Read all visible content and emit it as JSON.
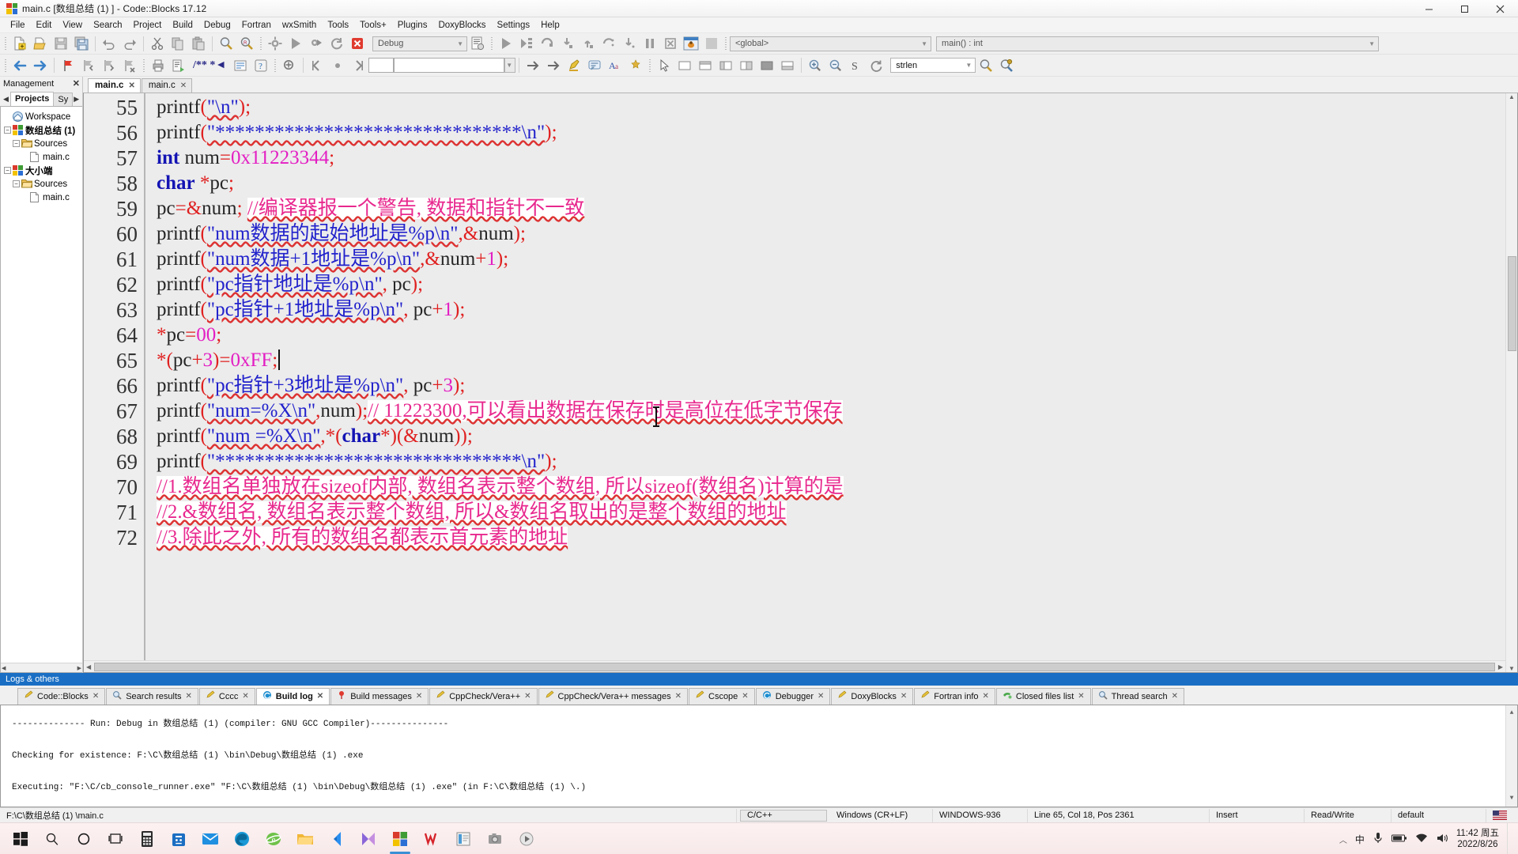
{
  "window": {
    "title": "main.c [数组总结 (1) ] - Code::Blocks 17.12",
    "icon": "codeblocks-logo-icon",
    "minimize": "—",
    "maximize": "▢",
    "close": "✕"
  },
  "menubar": {
    "items": [
      {
        "label": "File"
      },
      {
        "label": "Edit"
      },
      {
        "label": "View"
      },
      {
        "label": "Search"
      },
      {
        "label": "Project"
      },
      {
        "label": "Build"
      },
      {
        "label": "Debug"
      },
      {
        "label": "Fortran"
      },
      {
        "label": "wxSmith"
      },
      {
        "label": "Tools"
      },
      {
        "label": "Tools+"
      },
      {
        "label": "Plugins"
      },
      {
        "label": "DoxyBlocks"
      },
      {
        "label": "Settings"
      },
      {
        "label": "Help"
      }
    ]
  },
  "toolbar_main": {
    "build_target": "Debug",
    "scope_combo": "<global>",
    "function_combo": "main() : int"
  },
  "toolbar_second": {
    "doxy_label": "/** *◄",
    "search_field": "",
    "find_combo": "strlen"
  },
  "management": {
    "title": "Management",
    "close": "✕",
    "tabs": [
      {
        "label": "Projects",
        "active": true
      },
      {
        "label": "Sy",
        "active": false
      }
    ],
    "tree": [
      {
        "label": "Workspace",
        "level": 0,
        "icon": "workspace-icon",
        "expander": "",
        "bold": false
      },
      {
        "label": "数组总结 (1)",
        "level": 0,
        "icon": "project-icon",
        "expander": "−",
        "bold": true
      },
      {
        "label": "Sources",
        "level": 1,
        "icon": "folder-icon",
        "expander": "−",
        "bold": false
      },
      {
        "label": "main.c",
        "level": 2,
        "icon": "file-icon",
        "expander": "",
        "bold": false
      },
      {
        "label": "大小端",
        "level": 0,
        "icon": "project-icon",
        "expander": "−",
        "bold": true
      },
      {
        "label": "Sources",
        "level": 1,
        "icon": "folder-icon",
        "expander": "−",
        "bold": false
      },
      {
        "label": "main.c",
        "level": 2,
        "icon": "file-icon",
        "expander": "",
        "bold": false
      }
    ]
  },
  "editor": {
    "tabs": [
      {
        "label": "main.c",
        "active": true,
        "close": "✕"
      },
      {
        "label": "main.c",
        "active": false,
        "close": "✕"
      }
    ],
    "first_line": 55,
    "lines": [
      {
        "n": 55,
        "tokens": [
          {
            "t": "    ",
            "c": "plain"
          },
          {
            "t": "printf",
            "c": "plain"
          },
          {
            "t": "(",
            "c": "punc"
          },
          {
            "t": "\"\\n\"",
            "c": "str"
          },
          {
            "t": ")",
            "c": "punc"
          },
          {
            "t": ";",
            "c": "punc"
          }
        ]
      },
      {
        "n": 56,
        "tokens": [
          {
            "t": "    ",
            "c": "plain"
          },
          {
            "t": "printf",
            "c": "plain"
          },
          {
            "t": "(",
            "c": "punc"
          },
          {
            "t": "\"*******************************\\n\"",
            "c": "str"
          },
          {
            "t": ")",
            "c": "punc"
          },
          {
            "t": ";",
            "c": "punc"
          }
        ]
      },
      {
        "n": 57,
        "tokens": [
          {
            "t": "    ",
            "c": "plain"
          },
          {
            "t": "int",
            "c": "kw"
          },
          {
            "t": " num",
            "c": "plain"
          },
          {
            "t": "=",
            "c": "punc"
          },
          {
            "t": "0x11223344",
            "c": "num"
          },
          {
            "t": ";",
            "c": "punc"
          }
        ]
      },
      {
        "n": 58,
        "tokens": [
          {
            "t": "    ",
            "c": "plain"
          },
          {
            "t": "char",
            "c": "kw"
          },
          {
            "t": " ",
            "c": "plain"
          },
          {
            "t": "*",
            "c": "op"
          },
          {
            "t": "pc",
            "c": "plain"
          },
          {
            "t": ";",
            "c": "punc"
          }
        ]
      },
      {
        "n": 59,
        "tokens": [
          {
            "t": "    ",
            "c": "plain"
          },
          {
            "t": "pc",
            "c": "plain"
          },
          {
            "t": "=",
            "c": "punc"
          },
          {
            "t": "&",
            "c": "op"
          },
          {
            "t": "num",
            "c": "plain"
          },
          {
            "t": ";",
            "c": "punc"
          },
          {
            "t": "  ",
            "c": "plain"
          },
          {
            "t": "//编译器报一个警告,  数据和指针不一致",
            "c": "cmt"
          }
        ]
      },
      {
        "n": 60,
        "tokens": [
          {
            "t": "    ",
            "c": "plain"
          },
          {
            "t": "printf",
            "c": "plain"
          },
          {
            "t": "(",
            "c": "punc"
          },
          {
            "t": "\"num数据的起始地址是%p\\n\"",
            "c": "str"
          },
          {
            "t": ",",
            "c": "punc"
          },
          {
            "t": "&",
            "c": "op"
          },
          {
            "t": "num",
            "c": "plain"
          },
          {
            "t": ")",
            "c": "punc"
          },
          {
            "t": ";",
            "c": "punc"
          }
        ]
      },
      {
        "n": 61,
        "tokens": [
          {
            "t": "    ",
            "c": "plain"
          },
          {
            "t": "printf",
            "c": "plain"
          },
          {
            "t": "(",
            "c": "punc"
          },
          {
            "t": "\"num数据+1地址是%p\\n\"",
            "c": "str"
          },
          {
            "t": ",",
            "c": "punc"
          },
          {
            "t": "&",
            "c": "op"
          },
          {
            "t": "num",
            "c": "plain"
          },
          {
            "t": "+",
            "c": "punc"
          },
          {
            "t": "1",
            "c": "num"
          },
          {
            "t": ")",
            "c": "punc"
          },
          {
            "t": ";",
            "c": "punc"
          }
        ]
      },
      {
        "n": 62,
        "tokens": [
          {
            "t": "    ",
            "c": "plain"
          },
          {
            "t": "printf",
            "c": "plain"
          },
          {
            "t": "(",
            "c": "punc"
          },
          {
            "t": "\"pc指针地址是%p\\n\"",
            "c": "str"
          },
          {
            "t": ",",
            "c": "punc"
          },
          {
            "t": " pc",
            "c": "plain"
          },
          {
            "t": ")",
            "c": "punc"
          },
          {
            "t": ";",
            "c": "punc"
          }
        ]
      },
      {
        "n": 63,
        "tokens": [
          {
            "t": "    ",
            "c": "plain"
          },
          {
            "t": "printf",
            "c": "plain"
          },
          {
            "t": "(",
            "c": "punc"
          },
          {
            "t": "\"pc指针+1地址是%p\\n\"",
            "c": "str"
          },
          {
            "t": ",",
            "c": "punc"
          },
          {
            "t": " pc",
            "c": "plain"
          },
          {
            "t": "+",
            "c": "punc"
          },
          {
            "t": "1",
            "c": "num"
          },
          {
            "t": ")",
            "c": "punc"
          },
          {
            "t": ";",
            "c": "punc"
          }
        ]
      },
      {
        "n": 64,
        "tokens": [
          {
            "t": "    ",
            "c": "plain"
          },
          {
            "t": "*",
            "c": "op"
          },
          {
            "t": "pc",
            "c": "plain"
          },
          {
            "t": "=",
            "c": "punc"
          },
          {
            "t": "00",
            "c": "num"
          },
          {
            "t": ";",
            "c": "punc"
          }
        ]
      },
      {
        "n": 65,
        "tokens": [
          {
            "t": "    ",
            "c": "plain"
          },
          {
            "t": "*",
            "c": "op"
          },
          {
            "t": "(",
            "c": "punc"
          },
          {
            "t": "pc",
            "c": "plain"
          },
          {
            "t": "+",
            "c": "punc"
          },
          {
            "t": "3",
            "c": "num"
          },
          {
            "t": ")",
            "c": "punc"
          },
          {
            "t": "=",
            "c": "punc"
          },
          {
            "t": "0xFF",
            "c": "num"
          },
          {
            "t": ";",
            "c": "punc"
          }
        ],
        "caret": true
      },
      {
        "n": 66,
        "tokens": [
          {
            "t": "    ",
            "c": "plain"
          },
          {
            "t": "printf",
            "c": "plain"
          },
          {
            "t": "(",
            "c": "punc"
          },
          {
            "t": "\"pc指针+3地址是%p\\n\"",
            "c": "str"
          },
          {
            "t": ",",
            "c": "punc"
          },
          {
            "t": " pc",
            "c": "plain"
          },
          {
            "t": "+",
            "c": "punc"
          },
          {
            "t": "3",
            "c": "num"
          },
          {
            "t": ")",
            "c": "punc"
          },
          {
            "t": ";",
            "c": "punc"
          }
        ]
      },
      {
        "n": 67,
        "tokens": [
          {
            "t": "    ",
            "c": "plain"
          },
          {
            "t": "printf",
            "c": "plain"
          },
          {
            "t": "(",
            "c": "punc"
          },
          {
            "t": "\"num=%X\\n\"",
            "c": "str"
          },
          {
            "t": ",",
            "c": "punc"
          },
          {
            "t": "num",
            "c": "plain"
          },
          {
            "t": ")",
            "c": "punc"
          },
          {
            "t": ";",
            "c": "punc"
          },
          {
            "t": "//  11223300,可以看出数据在保存时是高位在低字节保存",
            "c": "cmt"
          }
        ]
      },
      {
        "n": 68,
        "tokens": [
          {
            "t": "    ",
            "c": "plain"
          },
          {
            "t": "printf",
            "c": "plain"
          },
          {
            "t": "(",
            "c": "punc"
          },
          {
            "t": "\"num =%X\\n\"",
            "c": "str"
          },
          {
            "t": ",",
            "c": "punc"
          },
          {
            "t": "*",
            "c": "op"
          },
          {
            "t": "(",
            "c": "punc"
          },
          {
            "t": "char",
            "c": "kw"
          },
          {
            "t": "*",
            "c": "op"
          },
          {
            "t": ")",
            "c": "punc"
          },
          {
            "t": "(",
            "c": "punc"
          },
          {
            "t": "&",
            "c": "op"
          },
          {
            "t": "num",
            "c": "plain"
          },
          {
            "t": ")",
            "c": "punc"
          },
          {
            "t": ")",
            "c": "punc"
          },
          {
            "t": ";",
            "c": "punc"
          }
        ]
      },
      {
        "n": 69,
        "tokens": [
          {
            "t": "    ",
            "c": "plain"
          },
          {
            "t": "printf",
            "c": "plain"
          },
          {
            "t": "(",
            "c": "punc"
          },
          {
            "t": "\"*******************************\\n\"",
            "c": "str"
          },
          {
            "t": ")",
            "c": "punc"
          },
          {
            "t": ";",
            "c": "punc"
          }
        ]
      },
      {
        "n": 70,
        "tokens": [
          {
            "t": "    ",
            "c": "plain"
          },
          {
            "t": "//1.数组名单独放在sizeof内部,  数组名表示整个数组,  所以sizeof(数组名)计算的是",
            "c": "cmt"
          }
        ]
      },
      {
        "n": 71,
        "tokens": [
          {
            "t": "    ",
            "c": "plain"
          },
          {
            "t": "//2.&数组名,  数组名表示整个数组,  所以&数组名取出的是整个数组的地址",
            "c": "cmt"
          }
        ]
      },
      {
        "n": 72,
        "tokens": [
          {
            "t": "    ",
            "c": "plain"
          },
          {
            "t": "//3.除此之外,  所有的数组名都表示首元素的地址",
            "c": "cmt"
          }
        ]
      }
    ]
  },
  "logs": {
    "panel_title": "Logs & others",
    "tabs": [
      {
        "label": "Code::Blocks",
        "icon": "pencil-icon",
        "active": false,
        "close": "✕"
      },
      {
        "label": "Search results",
        "icon": "magnifier-icon",
        "active": false,
        "close": "✕"
      },
      {
        "label": "Cccc",
        "icon": "pencil-icon",
        "active": false,
        "close": "✕"
      },
      {
        "label": "Build log",
        "icon": "refresh-icon",
        "active": true,
        "close": "✕"
      },
      {
        "label": "Build messages",
        "icon": "pin-icon",
        "active": false,
        "close": "✕"
      },
      {
        "label": "CppCheck/Vera++",
        "icon": "pencil-icon",
        "active": false,
        "close": "✕"
      },
      {
        "label": "CppCheck/Vera++ messages",
        "icon": "pencil-icon",
        "active": false,
        "close": "✕"
      },
      {
        "label": "Cscope",
        "icon": "pencil-icon",
        "active": false,
        "close": "✕"
      },
      {
        "label": "Debugger",
        "icon": "refresh-icon",
        "active": false,
        "close": "✕"
      },
      {
        "label": "DoxyBlocks",
        "icon": "pencil-icon",
        "active": false,
        "close": "✕"
      },
      {
        "label": "Fortran info",
        "icon": "pencil-icon",
        "active": false,
        "close": "✕"
      },
      {
        "label": "Closed files list",
        "icon": "files-icon",
        "active": false,
        "close": "✕"
      },
      {
        "label": "Thread search",
        "icon": "magnifier-icon",
        "active": false,
        "close": "✕"
      }
    ],
    "output": [
      "-------------- Run: Debug in 数组总结 (1)  (compiler: GNU GCC Compiler)---------------",
      "",
      "Checking for existence: F:\\C\\数组总结 (1) \\bin\\Debug\\数组总结 (1) .exe",
      "",
      "Executing: \"F:\\C/cb_console_runner.exe\" \"F:\\C\\数组总结 (1) \\bin\\Debug\\数组总结 (1) .exe\"  (in F:\\C\\数组总结 (1) \\.)"
    ]
  },
  "statusbar": {
    "path": "F:\\C\\数组总结 (1) \\main.c",
    "language": "C/C++",
    "eol": "Windows (CR+LF)",
    "encoding": "WINDOWS-936",
    "position": "Line 65, Col 18, Pos 2361",
    "mode": "Insert",
    "access": "Read/Write",
    "profile": "default"
  },
  "taskbar": {
    "icons": [
      {
        "name": "start-icon"
      },
      {
        "name": "search-icon"
      },
      {
        "name": "cortana-icon"
      },
      {
        "name": "taskview-icon"
      },
      {
        "name": "calculator-icon"
      },
      {
        "name": "store-icon"
      },
      {
        "name": "mail-icon"
      },
      {
        "name": "edge-icon"
      },
      {
        "name": "ie-icon"
      },
      {
        "name": "explorer-icon"
      },
      {
        "name": "feedback-icon"
      },
      {
        "name": "movies-icon"
      },
      {
        "name": "codeblocks-icon"
      },
      {
        "name": "wps-icon"
      },
      {
        "name": "notepad-icon"
      },
      {
        "name": "camera-icon"
      },
      {
        "name": "media-icon"
      }
    ],
    "clock_time": "11:42",
    "clock_weekday": "周五",
    "clock_date": "2022/8/26",
    "tray": [
      {
        "name": "ime-icon",
        "label": "中"
      },
      {
        "name": "mic-icon"
      },
      {
        "name": "battery-icon"
      },
      {
        "name": "network-icon"
      },
      {
        "name": "volume-icon"
      }
    ]
  },
  "colors": {
    "accent_blue": "#1a6fc4",
    "comment_pink": "#e8288e",
    "string_blue": "#2222cc",
    "keyword_blue": "#1414b4",
    "number_magenta": "#e31ec3",
    "operator_red": "#e02020"
  }
}
